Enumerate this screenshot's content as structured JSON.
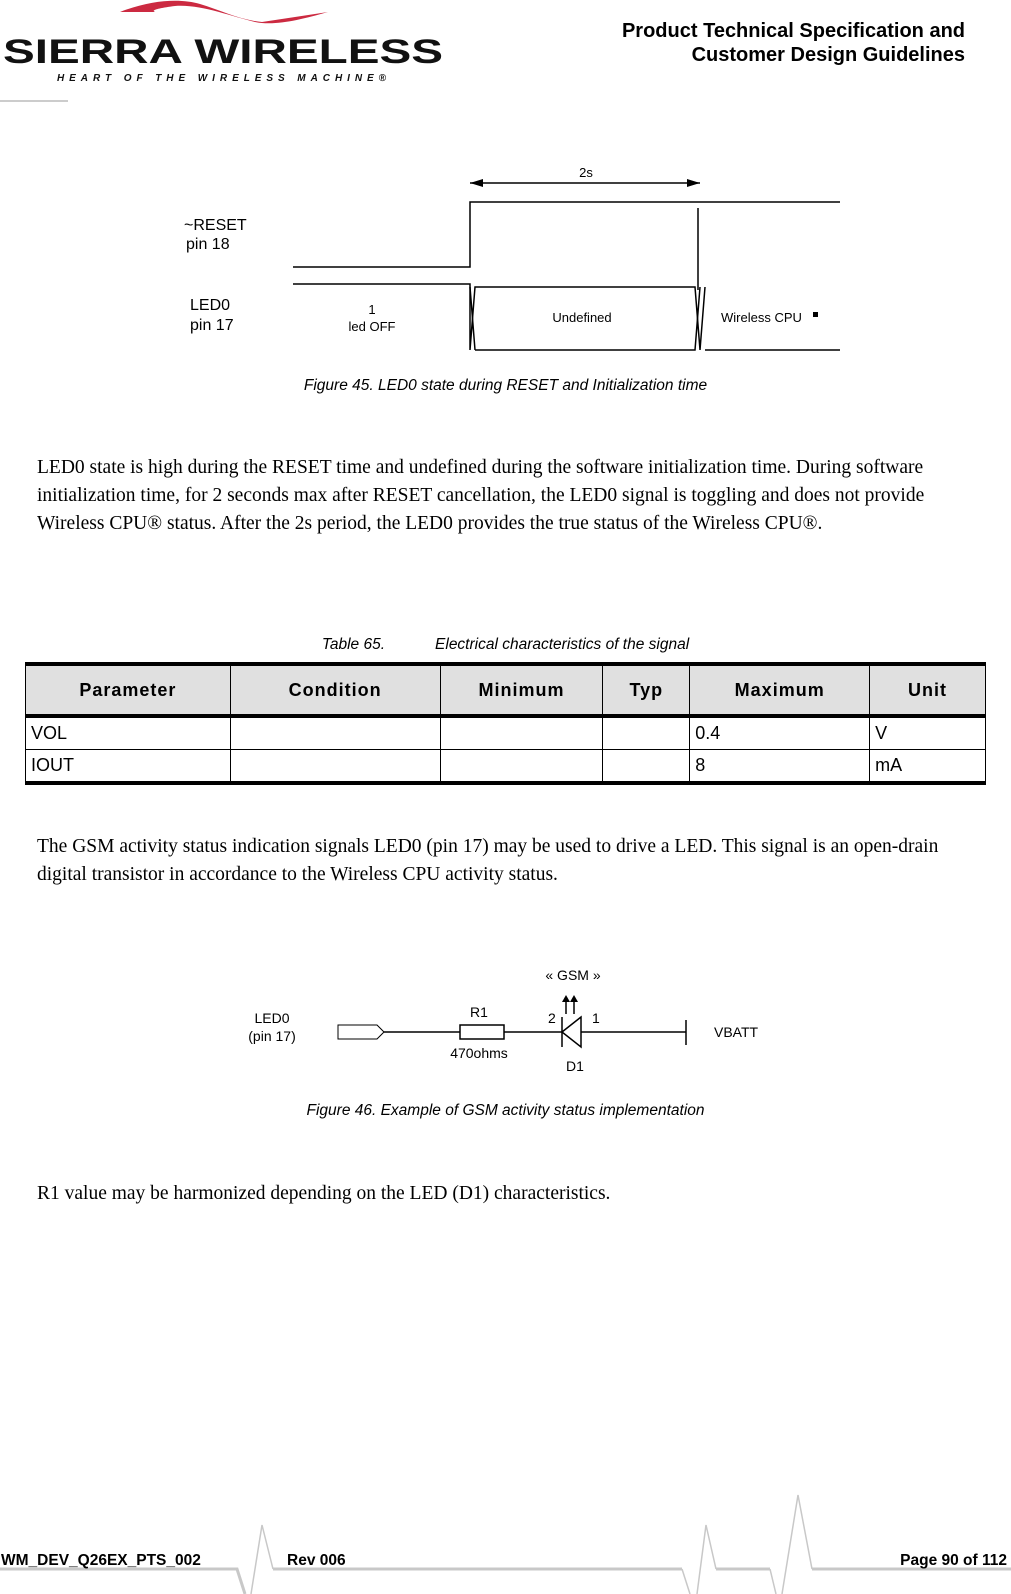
{
  "header": {
    "logo": {
      "brand": "SIERRA WIRELESS",
      "tagline": "HEART OF THE WIRELESS MACHINE®",
      "accent_color": "#cc2a41"
    },
    "title_line1": "Product Technical Specification and",
    "title_line2": "Customer Design Guidelines"
  },
  "figure45": {
    "reset_label_1": "~RESET",
    "reset_label_2": "pin 18",
    "led_label_1": "LED0",
    "led_label_2": "pin 17",
    "duration": "2s",
    "state1_a": "1",
    "state1_b": "led OFF",
    "state2": "Undefined",
    "state3": "Wireless CPU",
    "caption": "Figure 45. LED0 state during RESET and Initialization time"
  },
  "paragraph1": "LED0 state is high during the RESET time and undefined during the software initialization time. During software initialization time, for 2 seconds max after RESET cancellation, the LED0 signal is toggling and does not provide Wireless CPU® status. After the 2s period, the LED0 provides the true status of the Wireless CPU®.",
  "table65": {
    "caption_num": "Table 65.",
    "caption_title": "Electrical characteristics of the signal",
    "headers": [
      "Parameter",
      "Condition",
      "Minimum",
      "Typ",
      "Maximum",
      "Unit"
    ],
    "rows": [
      [
        "VOL",
        "",
        "",
        "",
        "0.4",
        "V"
      ],
      [
        "IOUT",
        "",
        "",
        "",
        "8",
        "mA"
      ]
    ]
  },
  "paragraph2": "The GSM activity status indication signals LED0 (pin 17) may be used to drive a LED. This signal is an open-drain digital transistor in accordance to the Wireless CPU activity status.",
  "figure46": {
    "led_label_1": "LED0",
    "led_label_2": "(pin 17)",
    "r_name": "R1",
    "r_value": "470ohms",
    "pin2": "2",
    "pin1": "1",
    "gsm": "« GSM »",
    "d_name": "D1",
    "vbatt": "VBATT",
    "caption": "Figure 46. Example of GSM activity status implementation"
  },
  "paragraph3": "R1 value may be harmonized depending on the LED (D1) characteristics.",
  "footer": {
    "doc_id": "WM_DEV_Q26EX_PTS_002",
    "rev": "Rev 006",
    "page": "Page 90 of 112"
  }
}
